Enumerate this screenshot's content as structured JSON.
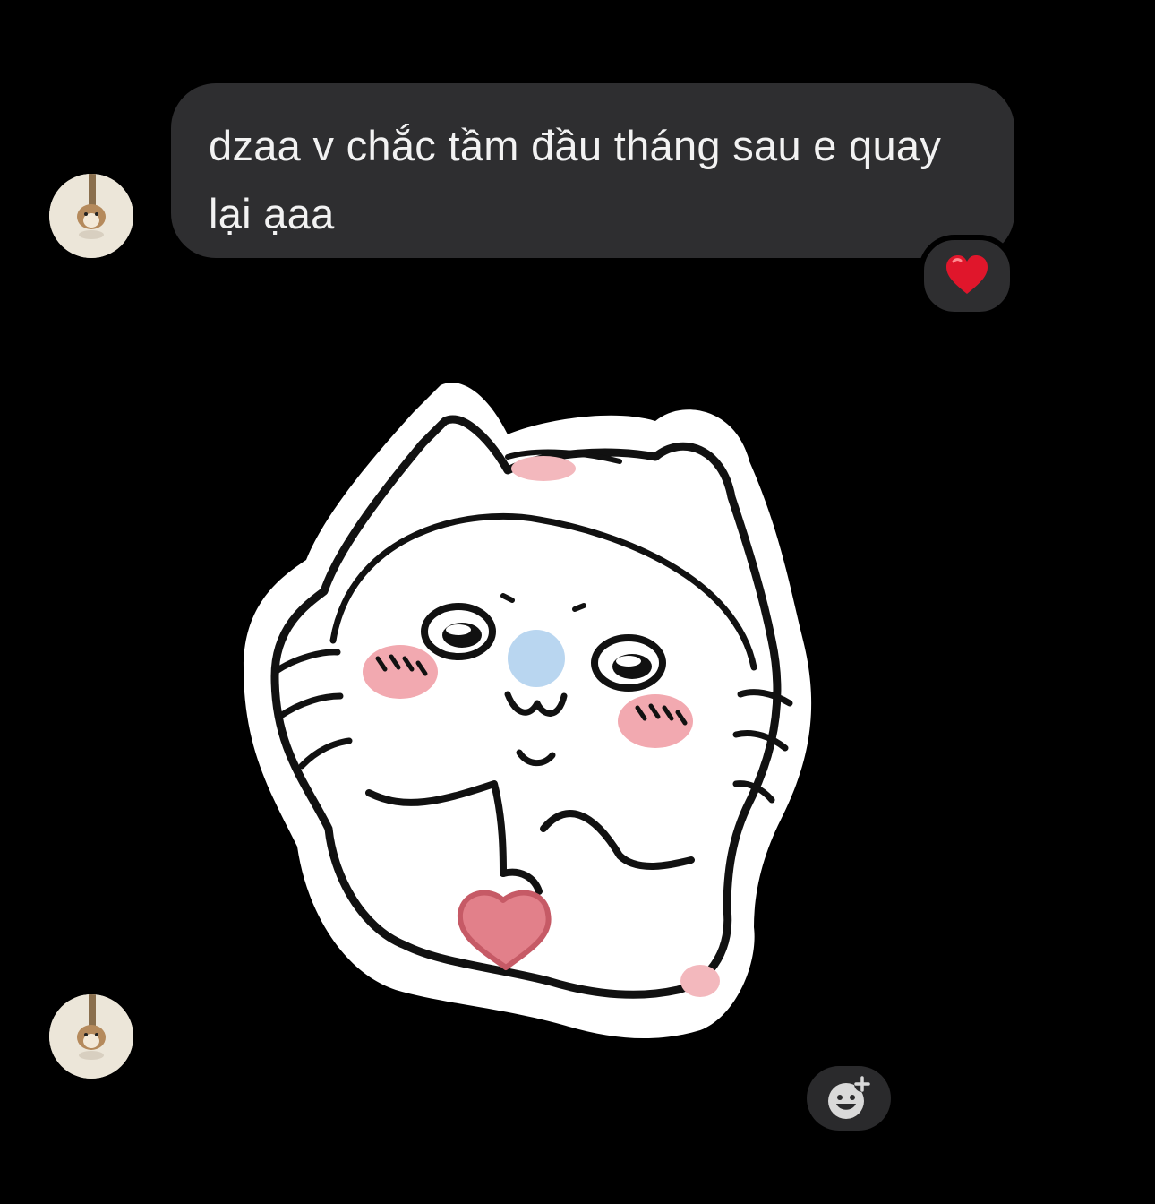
{
  "messages": [
    {
      "sender": "other",
      "type": "text",
      "text": "dzaa v chắc tầm đầu tháng sau e quay lại ạaa",
      "reaction": "❤️"
    },
    {
      "sender": "other",
      "type": "sticker",
      "sticker_icon": "white-cat-ghost-heart-sticker"
    }
  ],
  "actions": {
    "add_reaction_icon": "smiley-plus-icon"
  },
  "colors": {
    "background": "#000000",
    "bubble": "#2e2e30",
    "bubble_text": "#f2f2f2",
    "reaction_heart": "#e0162b"
  }
}
